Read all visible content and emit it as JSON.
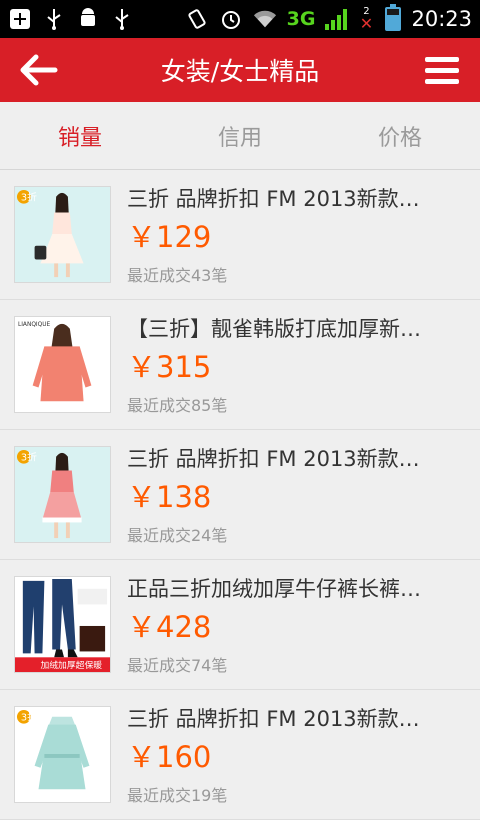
{
  "statusbar": {
    "network": "3G",
    "sim_number": "2",
    "time": "20:23"
  },
  "header": {
    "title": "女装/女士精品"
  },
  "tabs": [
    {
      "label": "销量",
      "active": true
    },
    {
      "label": "信用",
      "active": false
    },
    {
      "label": "价格",
      "active": false
    }
  ],
  "items": [
    {
      "title": "三折 品牌折扣 FM 2013新款…",
      "price": "￥129",
      "sales": "最近成交43笔",
      "badge": "3折"
    },
    {
      "title": "【三折】靓雀韩版打底加厚新…",
      "price": "￥315",
      "sales": "最近成交85笔",
      "brand": "LIANQIQUE"
    },
    {
      "title": "三折 品牌折扣 FM 2013新款…",
      "price": "￥138",
      "sales": "最近成交24笔",
      "badge": "3折"
    },
    {
      "title": "正品三折加绒加厚牛仔裤长裤…",
      "price": "￥428",
      "sales": "最近成交74笔",
      "banner": "加绒加厚超保暖"
    },
    {
      "title": "三折 品牌折扣 FM 2013新款…",
      "price": "￥160",
      "sales": "最近成交19笔",
      "badge": "3折"
    }
  ],
  "colors": {
    "brand": "#d81f27",
    "price": "#ff5a00"
  }
}
